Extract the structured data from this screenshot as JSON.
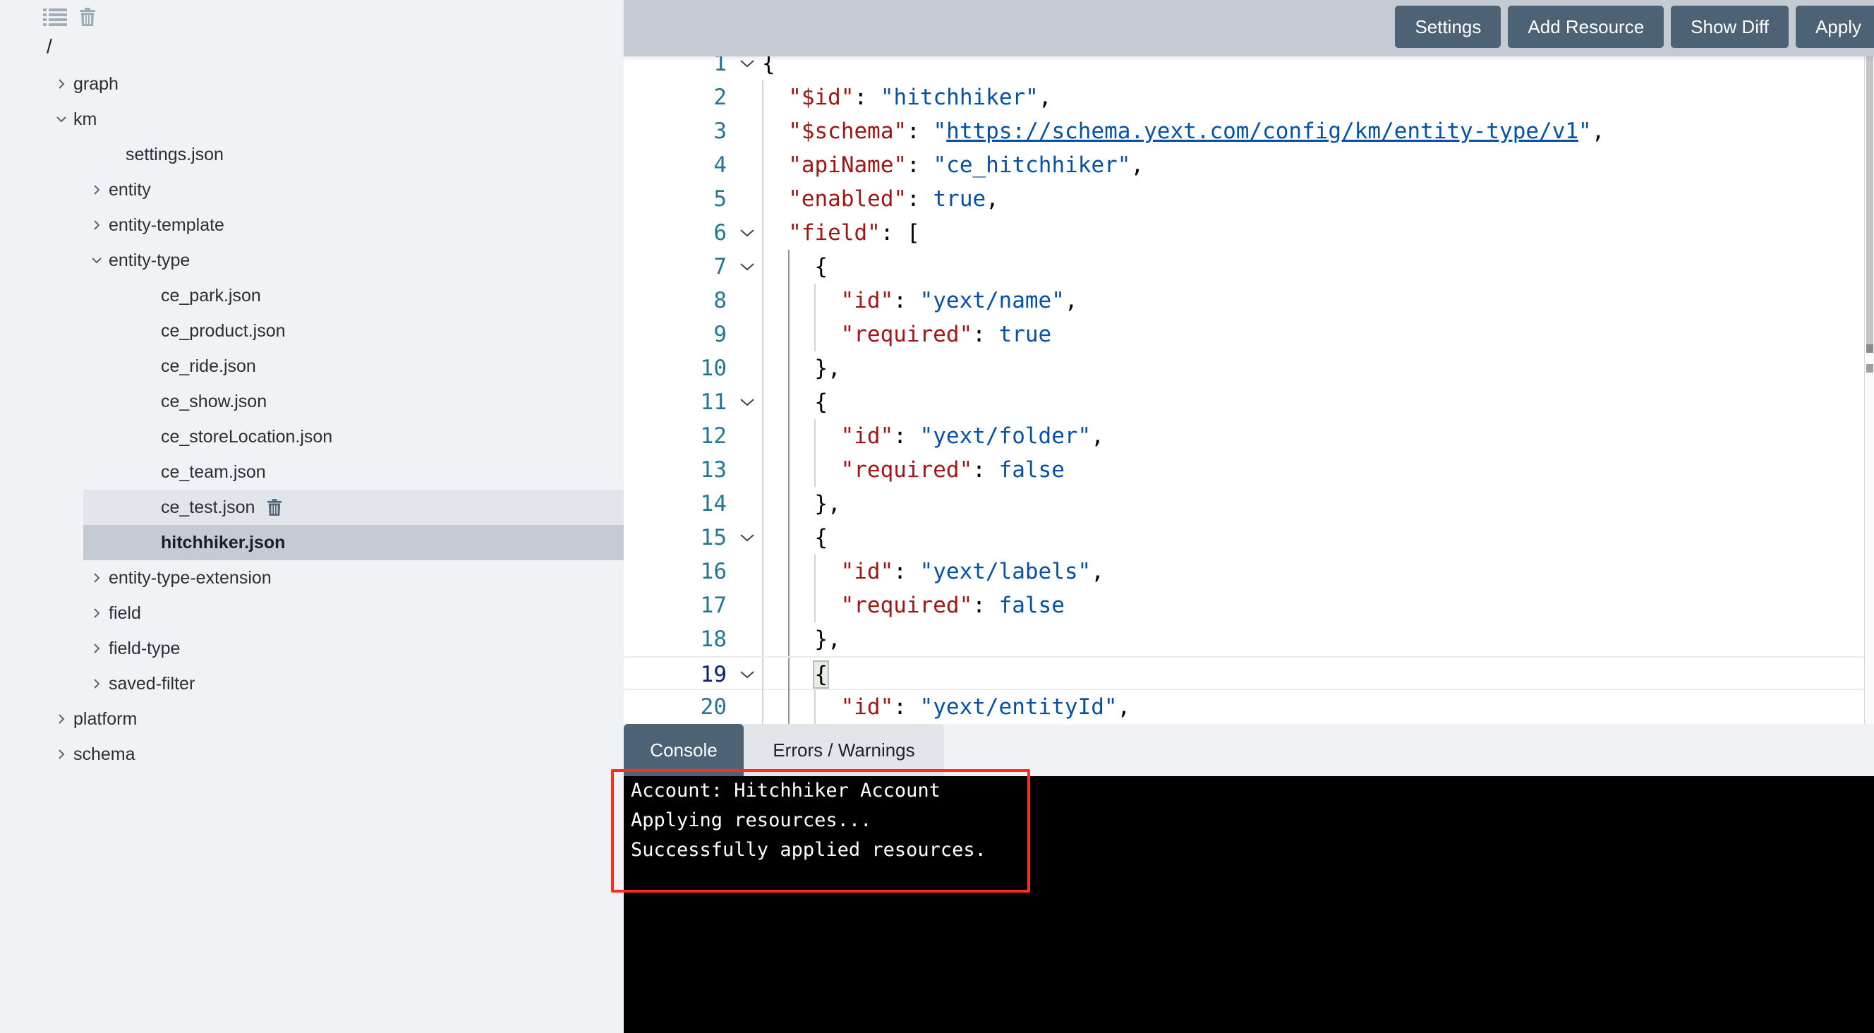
{
  "sidebar": {
    "toolbar": {
      "list_icon": "list-icon",
      "trash_icon": "trash-icon"
    },
    "root": "/",
    "tree": [
      {
        "label": "graph",
        "depth": 0,
        "type": "folder",
        "expanded": false
      },
      {
        "label": "km",
        "depth": 0,
        "type": "folder",
        "expanded": true
      },
      {
        "label": "settings.json",
        "depth": 1,
        "type": "file"
      },
      {
        "label": "entity",
        "depth": 1,
        "type": "folder",
        "expanded": false
      },
      {
        "label": "entity-template",
        "depth": 1,
        "type": "folder",
        "expanded": false
      },
      {
        "label": "entity-type",
        "depth": 1,
        "type": "folder",
        "expanded": true
      },
      {
        "label": "ce_park.json",
        "depth": 2,
        "type": "file"
      },
      {
        "label": "ce_product.json",
        "depth": 2,
        "type": "file"
      },
      {
        "label": "ce_ride.json",
        "depth": 2,
        "type": "file"
      },
      {
        "label": "ce_show.json",
        "depth": 2,
        "type": "file"
      },
      {
        "label": "ce_storeLocation.json",
        "depth": 2,
        "type": "file"
      },
      {
        "label": "ce_team.json",
        "depth": 2,
        "type": "file"
      },
      {
        "label": "ce_test.json",
        "depth": 2,
        "type": "file",
        "state": "hover",
        "show_trash": true
      },
      {
        "label": "hitchhiker.json",
        "depth": 2,
        "type": "file",
        "state": "selected"
      },
      {
        "label": "entity-type-extension",
        "depth": 1,
        "type": "folder",
        "expanded": false
      },
      {
        "label": "field",
        "depth": 1,
        "type": "folder",
        "expanded": false
      },
      {
        "label": "field-type",
        "depth": 1,
        "type": "folder",
        "expanded": false
      },
      {
        "label": "saved-filter",
        "depth": 1,
        "type": "folder",
        "expanded": false
      },
      {
        "label": "platform",
        "depth": 0,
        "type": "folder",
        "expanded": false
      },
      {
        "label": "schema",
        "depth": 0,
        "type": "folder",
        "expanded": false
      }
    ]
  },
  "toolbar": {
    "settings_label": "Settings",
    "add_resource_label": "Add Resource",
    "show_diff_label": "Show Diff",
    "apply_label": "Apply"
  },
  "editor": {
    "current_line": 19,
    "lines": [
      {
        "n": 1,
        "indent": 0,
        "fold": true,
        "tokens": [
          [
            "punc",
            "{"
          ]
        ]
      },
      {
        "n": 2,
        "indent": 1,
        "tokens": [
          [
            "key",
            "\"$id\""
          ],
          [
            "punc",
            ": "
          ],
          [
            "str",
            "\"hitchhiker\""
          ],
          [
            "punc",
            ","
          ]
        ]
      },
      {
        "n": 3,
        "indent": 1,
        "tokens": [
          [
            "key",
            "\"$schema\""
          ],
          [
            "punc",
            ": "
          ],
          [
            "str",
            "\""
          ],
          [
            "link",
            "https://schema.yext.com/config/km/entity-type/v1"
          ],
          [
            "str",
            "\""
          ],
          [
            "punc",
            ","
          ]
        ]
      },
      {
        "n": 4,
        "indent": 1,
        "tokens": [
          [
            "key",
            "\"apiName\""
          ],
          [
            "punc",
            ": "
          ],
          [
            "str",
            "\"ce_hitchhiker\""
          ],
          [
            "punc",
            ","
          ]
        ]
      },
      {
        "n": 5,
        "indent": 1,
        "tokens": [
          [
            "key",
            "\"enabled\""
          ],
          [
            "punc",
            ": "
          ],
          [
            "bool",
            "true"
          ],
          [
            "punc",
            ","
          ]
        ]
      },
      {
        "n": 6,
        "indent": 1,
        "fold": true,
        "tokens": [
          [
            "key",
            "\"field\""
          ],
          [
            "punc",
            ": ["
          ]
        ]
      },
      {
        "n": 7,
        "indent": 2,
        "fold": true,
        "tokens": [
          [
            "punc",
            "{"
          ]
        ]
      },
      {
        "n": 8,
        "indent": 3,
        "tokens": [
          [
            "key",
            "\"id\""
          ],
          [
            "punc",
            ": "
          ],
          [
            "str",
            "\"yext/name\""
          ],
          [
            "punc",
            ","
          ]
        ]
      },
      {
        "n": 9,
        "indent": 3,
        "tokens": [
          [
            "key",
            "\"required\""
          ],
          [
            "punc",
            ": "
          ],
          [
            "bool",
            "true"
          ]
        ]
      },
      {
        "n": 10,
        "indent": 2,
        "tokens": [
          [
            "punc",
            "},"
          ]
        ]
      },
      {
        "n": 11,
        "indent": 2,
        "fold": true,
        "tokens": [
          [
            "punc",
            "{"
          ]
        ]
      },
      {
        "n": 12,
        "indent": 3,
        "tokens": [
          [
            "key",
            "\"id\""
          ],
          [
            "punc",
            ": "
          ],
          [
            "str",
            "\"yext/folder\""
          ],
          [
            "punc",
            ","
          ]
        ]
      },
      {
        "n": 13,
        "indent": 3,
        "tokens": [
          [
            "key",
            "\"required\""
          ],
          [
            "punc",
            ": "
          ],
          [
            "bool",
            "false"
          ]
        ]
      },
      {
        "n": 14,
        "indent": 2,
        "tokens": [
          [
            "punc",
            "},"
          ]
        ]
      },
      {
        "n": 15,
        "indent": 2,
        "fold": true,
        "tokens": [
          [
            "punc",
            "{"
          ]
        ]
      },
      {
        "n": 16,
        "indent": 3,
        "tokens": [
          [
            "key",
            "\"id\""
          ],
          [
            "punc",
            ": "
          ],
          [
            "str",
            "\"yext/labels\""
          ],
          [
            "punc",
            ","
          ]
        ]
      },
      {
        "n": 17,
        "indent": 3,
        "tokens": [
          [
            "key",
            "\"required\""
          ],
          [
            "punc",
            ": "
          ],
          [
            "bool",
            "false"
          ]
        ]
      },
      {
        "n": 18,
        "indent": 2,
        "tokens": [
          [
            "punc",
            "},"
          ]
        ]
      },
      {
        "n": 19,
        "indent": 2,
        "fold": true,
        "bracket_match": true,
        "tokens": [
          [
            "punc",
            "{"
          ]
        ]
      },
      {
        "n": 20,
        "indent": 3,
        "tokens": [
          [
            "key",
            "\"id\""
          ],
          [
            "punc",
            ": "
          ],
          [
            "str",
            "\"yext/entityId\""
          ],
          [
            "punc",
            ","
          ]
        ]
      }
    ]
  },
  "console": {
    "tabs": [
      {
        "label": "Console",
        "active": true
      },
      {
        "label": "Errors / Warnings",
        "active": false
      }
    ],
    "lines": [
      "Account: Hitchhiker Account",
      "Applying resources...",
      "Successfully applied resources."
    ]
  },
  "colors": {
    "button_bg": "#4e6275",
    "topbar_bg": "#c4cbd3",
    "sidebar_bg": "#f0f2f5",
    "selected_row": "#c4cbd3",
    "hover_row": "#e2e5e9",
    "json_key": "#a31515",
    "json_value": "#0451a5",
    "line_number": "#237893",
    "annotation": "#ff2d1a"
  }
}
